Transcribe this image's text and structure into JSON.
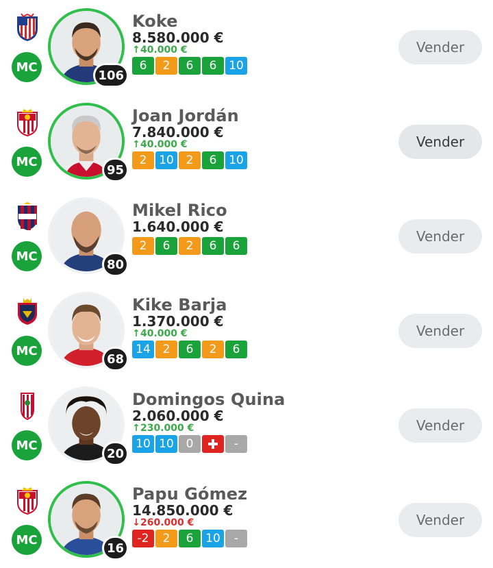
{
  "sell_label": "Vender",
  "colors": {
    "position_badge": "#1aa33a",
    "ring": "#2fbf4a",
    "score_green": "#1aa33a",
    "score_orange": "#f39a1b",
    "score_blue": "#1ba3e8",
    "score_grey": "#a8a8a8",
    "score_red": "#e0241f",
    "price_up": "#3ca94a",
    "price_down": "#d9302b"
  },
  "players": [
    {
      "club_icon": "atletico-crest-icon",
      "position": "MC",
      "name": "Koke",
      "points": "106",
      "price": "8.580.000 €",
      "delta": {
        "dir": "up",
        "text": "40.000 €"
      },
      "scores": [
        {
          "v": "6",
          "c": "green"
        },
        {
          "v": "2",
          "c": "orange"
        },
        {
          "v": "6",
          "c": "green"
        },
        {
          "v": "6",
          "c": "green"
        },
        {
          "v": "10",
          "c": "blue"
        }
      ]
    },
    {
      "club_icon": "sevilla-crest-icon",
      "position": "MC",
      "name": "Joan Jordán",
      "points": "95",
      "price": "7.840.000 €",
      "delta": {
        "dir": "up",
        "text": "40.000 €"
      },
      "scores": [
        {
          "v": "2",
          "c": "orange"
        },
        {
          "v": "10",
          "c": "blue"
        },
        {
          "v": "2",
          "c": "orange"
        },
        {
          "v": "6",
          "c": "green"
        },
        {
          "v": "10",
          "c": "blue"
        }
      ]
    },
    {
      "club_icon": "huesca-crest-icon",
      "position": "MC",
      "name": "Mikel Rico",
      "points": "80",
      "price": "1.640.000 €",
      "delta": null,
      "scores": [
        {
          "v": "2",
          "c": "orange"
        },
        {
          "v": "6",
          "c": "green"
        },
        {
          "v": "2",
          "c": "orange"
        },
        {
          "v": "6",
          "c": "green"
        },
        {
          "v": "6",
          "c": "green"
        }
      ]
    },
    {
      "club_icon": "osasuna-crest-icon",
      "position": "MC",
      "name": "Kike Barja",
      "points": "68",
      "price": "1.370.000 €",
      "delta": {
        "dir": "up",
        "text": "40.000 €"
      },
      "scores": [
        {
          "v": "14",
          "c": "blue"
        },
        {
          "v": "2",
          "c": "orange"
        },
        {
          "v": "6",
          "c": "green"
        },
        {
          "v": "2",
          "c": "orange"
        },
        {
          "v": "6",
          "c": "green"
        }
      ]
    },
    {
      "club_icon": "granada-crest-icon",
      "position": "MC",
      "name": "Domingos Quina",
      "points": "20",
      "price": "2.060.000 €",
      "delta": {
        "dir": "up",
        "text": "230.000 €"
      },
      "scores": [
        {
          "v": "10",
          "c": "blue"
        },
        {
          "v": "10",
          "c": "blue"
        },
        {
          "v": "0",
          "c": "grey"
        },
        {
          "v": "",
          "c": "cross",
          "icon": "injury-cross-icon"
        },
        {
          "v": "-",
          "c": "grey"
        }
      ]
    },
    {
      "club_icon": "sevilla-crest-icon",
      "position": "MC",
      "name": "Papu Gómez",
      "points": "16",
      "price": "14.850.000 €",
      "delta": {
        "dir": "down",
        "text": "260.000 €"
      },
      "scores": [
        {
          "v": "-2",
          "c": "red"
        },
        {
          "v": "2",
          "c": "orange"
        },
        {
          "v": "6",
          "c": "green"
        },
        {
          "v": "10",
          "c": "blue"
        },
        {
          "v": "-",
          "c": "grey"
        }
      ]
    }
  ]
}
